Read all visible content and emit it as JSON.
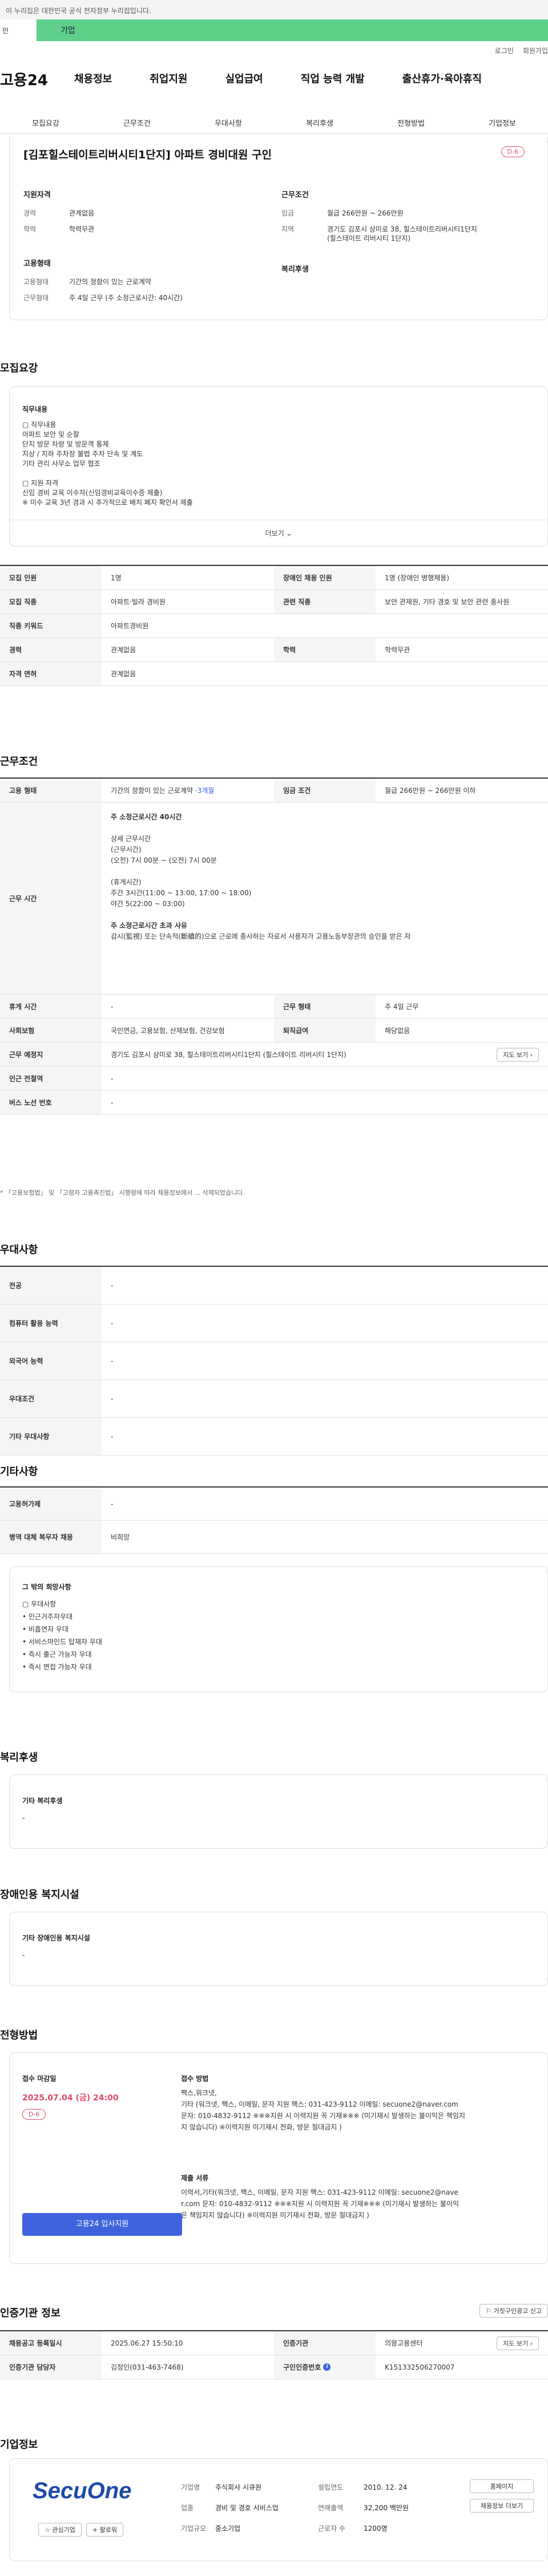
{
  "gov_strip": "이 누리집은 대한민국 공식 전자정부 누리집입니다.",
  "search": {
    "left_tab": "인",
    "green_tab": "기업"
  },
  "util": {
    "login": "로그인",
    "join": "회원가입"
  },
  "brand": {
    "logo": "고용24"
  },
  "gnb": [
    "채용정보",
    "취업지원",
    "실업급여",
    "직업 능력 개발",
    "출산휴가·육아휴직"
  ],
  "tabs": [
    "모집요강",
    "근무조건",
    "우대사항",
    "복리후생",
    "전형방법",
    "기업정보"
  ],
  "summary": {
    "title": "[김포힐스테이트리버시티1단지] 아파트 경비대원 구인",
    "dday": "D-6",
    "left_heading": "지원자격",
    "career_k": "경력",
    "career_v": "관계없음",
    "edu_k": "학력",
    "edu_v": "학력무관",
    "emp_heading": "고용형태",
    "emp_k": "고용형태",
    "emp_v": "기간의 정함이 있는 근로계약",
    "work_k": "근무형태",
    "work_v": "주 4일 근무 (주 소정근로시간: 40시간)",
    "right_heading": "근무조건",
    "wage_k": "임금",
    "wage_v": "월급 266만원 ~ 266만원",
    "area_k": "지역",
    "area_v1": "경기도 김포시 상미로 38, 힐스테이트리버시티1단지",
    "area_v2": "(힐스테이트 리버시티 1단지)",
    "welfare_heading": "복리후생"
  },
  "recruit": {
    "heading": "모집요강",
    "box_title": "직무내용",
    "lines": [
      "▢ 직무내용",
      "아파트 보안 및 순찰",
      "단지 방문 차량 및 방문객 통제",
      "지상 / 지하 주차장 불법 주차 단속 및 계도",
      "기타 관리 사무소 업무 협조",
      "",
      "▢ 지원 자격",
      "신임 경비 교육 이수자(신임경비교육이수증 제출)",
      " ※ 미수 교육 3년 경과 시 추가적으로 배치 폐지 확인서 제출"
    ],
    "more": "더보기",
    "rows": [
      {
        "k1": "모집 인원",
        "v1": "1명",
        "k2": "장애인 채용 인원",
        "v2": "1명 (장애인 병행채용)"
      },
      {
        "k1": "모집 직종",
        "v1": "아파트·빌라 경비원",
        "k2": "관련 직종",
        "v2": "보안 관제원, 기타 경호 및 보안 관련 종사원"
      },
      {
        "k1": "직종 키워드",
        "v1": "아파트경비원"
      },
      {
        "k1": "경력",
        "v1": "관계없음",
        "k2": "학력",
        "v2": "학력무관"
      },
      {
        "k1": "자격 면허",
        "v1": "관계없음"
      }
    ]
  },
  "work": {
    "heading": "근무조건",
    "emp_k": "고용 형태",
    "emp_v": "기간의 정함이 있는 근로계약 · ",
    "emp_link": "3개월",
    "wage_k": "임금 조건",
    "wage_v": "월급 266만원 ~ 266만원 이하",
    "time_k": "근무 시간",
    "time_lines": [
      "주 소정근로시간  40시간",
      "",
      "상세 근무시간",
      "(근무시간)",
      "(오전) 7시 00분 ~ (오전) 7시 00분",
      "",
      "(휴게시간)",
      "주간 3시간(11:00 ~ 13:00, 17:00 ~ 18:00)",
      "야간 5(22:00 ~ 03:00)",
      "",
      "주 소정근로시간 초과 사유",
      "감시(監視) 또는 단속적(斷續的)으로 근로에 종사하는 자로서 사용자가 고용노동부장관의 승인을 받은 자"
    ],
    "rest_k": "휴게 시간",
    "rest_v": "-",
    "form_k": "근무 형태",
    "form_v": "주 4일 근무",
    "ins_k": "사회보험",
    "ins_v": "국민연금, 고용보험, 산재보험, 건강보험",
    "sev_k": "퇴직급여",
    "sev_v": "해당없음",
    "place_k": "근무 예정지",
    "place_v": "경기도 김포시 상미로 38, 힐스테이트리버시티1단지 (힐스테이트 리버시티 1단지)",
    "map_btn": "지도 보기",
    "subway_k": "인근 전철역",
    "subway_v": "-",
    "bus_k": "버스 노선 번호",
    "bus_v": "-",
    "note": "* 「고용보험법」 및 「고령자 고용촉진법」 시행령에 따라 채용정보에서 ... 삭제되었습니다."
  },
  "pref": {
    "heading": "우대사항",
    "rows": [
      {
        "k": "전공",
        "v": "-"
      },
      {
        "k": "컴퓨터 활용 능력",
        "v": "-"
      },
      {
        "k": "외국어 능력",
        "v": "-"
      },
      {
        "k": "우대조건",
        "v": "-"
      },
      {
        "k": "기타 우대사항",
        "v": "-"
      }
    ]
  },
  "etc": {
    "heading": "기타사항",
    "rows": [
      {
        "k": "고용허가제",
        "v": "-"
      },
      {
        "k": "병역 대체 복무자 채용",
        "v": "비희망"
      }
    ],
    "box_title": "그 밖의 희망사항",
    "box_lines": [
      "▢ 우대사항",
      "• 인근거주자우대",
      "• 비흡연자 우대",
      "• 서비스마인드 탑재자 우대",
      "• 즉시 출근 가능자 우대",
      "• 즉시 면접 가능자 우대"
    ]
  },
  "welfare": {
    "heading": "복리후생",
    "box_title": "기타 복리후생",
    "value": "-"
  },
  "disabled": {
    "heading": "장애인용 복지시설",
    "box_title": "기타 장애인용 복지시설",
    "value": "-"
  },
  "process": {
    "heading": "전형방법",
    "deadline_label": "접수 마감일",
    "deadline": "2025.07.04 (금) 24:00",
    "dday": "D-6",
    "apply_btn": "고용24 입사지원",
    "method_label": "접수 방법",
    "method_lines": [
      "팩스,워크넷,",
      "기타 (워크넷, 팩스, 이메일, 문자 지원 팩스: 031-423-9112 이메일: secuone2@naver.com",
      "문자: 010-4832-9112 ※※※지원 시 이력지원 꼭 기재※※※ (미기재시 발생하는 불이익은 책임지",
      "지 않습니다) ※이력지원 미기재시 전화, 방문 절대금지 )"
    ],
    "doc_label": "제출 서류",
    "doc_lines": [
      "이력서,기타(워크넷, 팩스, 이메일, 문자 지원 팩스: 031-423-9112 이메일: secuone2@nave",
      "r.com 문자: 010-4832-9112 ※※※지원 시 이력지원 꼭 기재※※※ (미기재시 발생하는 불이익",
      "은 책임지지 않습니다) ※이력지원 미기재시 전화, 방문 절대금지 )"
    ]
  },
  "auth": {
    "heading": "인증기관 정보",
    "report_btn": "거짓구인광고 신고",
    "reg_k": "채용공고 등록일시",
    "reg_v": "2025.06.27 15:50:10",
    "org_k": "인증기관",
    "org_v": "의왕고용센터",
    "org_btn": "지도 보기",
    "mgr_k": "인증기관 담당자",
    "mgr_v": "김정인(031-463-7468)",
    "num_k": "구인인증번호",
    "num_v": "K151332506270007"
  },
  "company": {
    "heading": "기업정보",
    "logo": "SecuOne",
    "fav_btn": "관심기업",
    "follow_btn": "팔로워",
    "homepage_btn": "홈페이지",
    "more_btn": "채용정보 더보기",
    "info": [
      {
        "k": "기업명",
        "v": "주식회사 시큐원"
      },
      {
        "k": "업종",
        "v": "경비 및 경호 서비스업"
      },
      {
        "k": "기업규모",
        "v": "중소기업"
      }
    ],
    "info2": [
      {
        "k": "설립연도",
        "v": "2010. 12. 24"
      },
      {
        "k": "연매출액",
        "v": "32,200 백만원"
      },
      {
        "k": "근로자 수",
        "v": "1200명"
      }
    ]
  }
}
